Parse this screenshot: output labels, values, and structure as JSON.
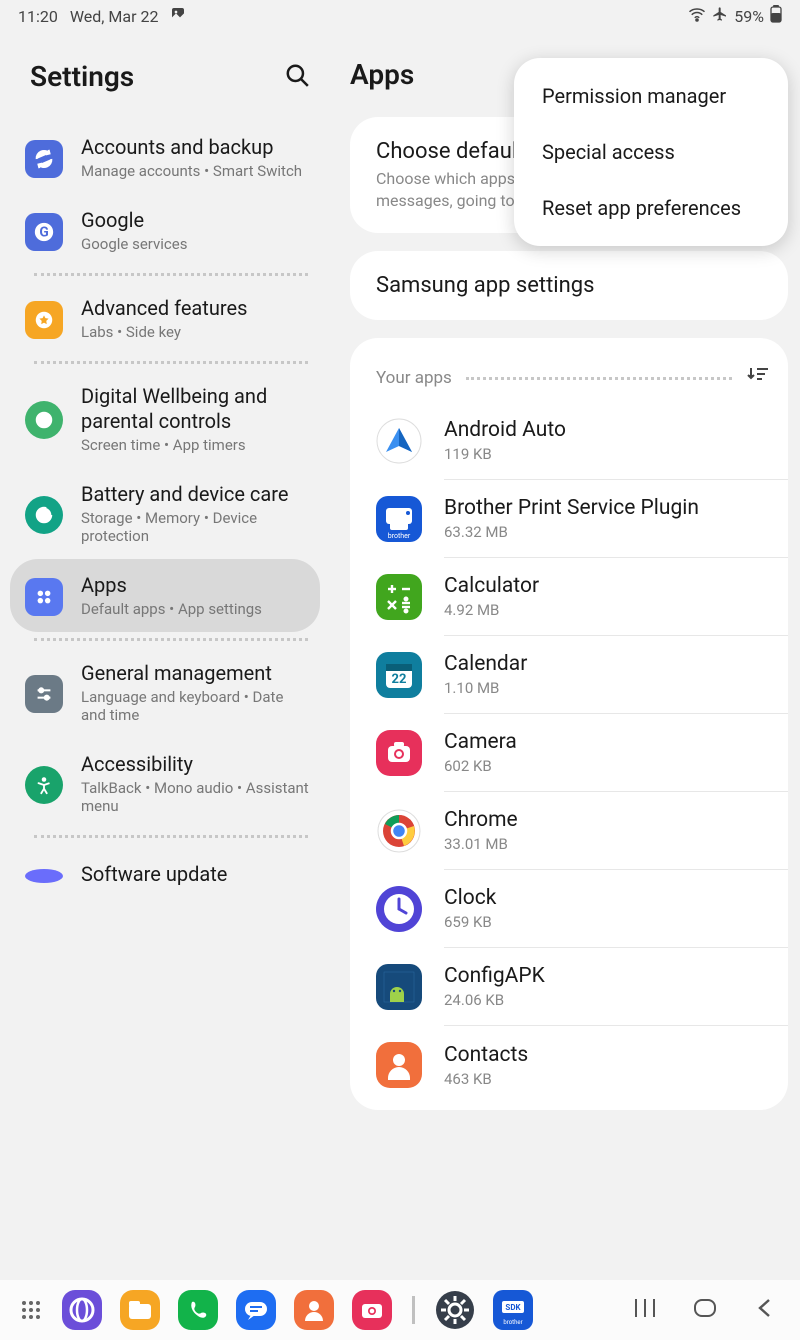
{
  "status": {
    "time": "11:20",
    "date": "Wed, Mar 22",
    "battery": "59%"
  },
  "left": {
    "title": "Settings",
    "items": [
      {
        "title": "Accounts and backup",
        "sub": "Manage accounts  •  Smart Switch",
        "color": "#4e6cdb",
        "icon": "sync"
      },
      {
        "title": "Google",
        "sub": "Google services",
        "color": "#4e6cdb",
        "icon": "google"
      }
    ],
    "item_adv": {
      "title": "Advanced features",
      "sub": "Labs  •  Side key",
      "color": "#f6a624",
      "icon": "gear-badge"
    },
    "item_wb": {
      "title": "Digital Wellbeing and parental controls",
      "sub": "Screen time  •  App timers",
      "color": "#3fb36d",
      "icon": "heart"
    },
    "item_bat": {
      "title": "Battery and device care",
      "sub": "Storage  •  Memory  •  Device protection",
      "color": "#12a386",
      "icon": "care"
    },
    "item_apps": {
      "title": "Apps",
      "sub": "Default apps  •  App settings",
      "color": "#5978f0",
      "icon": "grid"
    },
    "item_gm": {
      "title": "General management",
      "sub": "Language and keyboard  •  Date and time",
      "color": "#6b7a86",
      "icon": "sliders"
    },
    "item_acc": {
      "title": "Accessibility",
      "sub": "TalkBack  •  Mono audio  •  Assistant menu",
      "color": "#19a36b",
      "icon": "person"
    },
    "item_cut": {
      "title": "Software update"
    }
  },
  "right": {
    "title": "Apps",
    "card_default": {
      "title": "Choose default apps",
      "sub": "Choose which apps to use for making calls, sending messages, going to websites, and more."
    },
    "card_samsung": {
      "title": "Samsung app settings"
    },
    "your_apps_label": "Your apps",
    "apps": [
      {
        "name": "Android Auto",
        "size": "119 KB"
      },
      {
        "name": "Brother Print Service Plugin",
        "size": "63.32 MB"
      },
      {
        "name": "Calculator",
        "size": "4.92 MB"
      },
      {
        "name": "Calendar",
        "size": "1.10 MB"
      },
      {
        "name": "Camera",
        "size": "602 KB"
      },
      {
        "name": "Chrome",
        "size": "33.01 MB"
      },
      {
        "name": "Clock",
        "size": "659 KB"
      },
      {
        "name": "ConfigAPK",
        "size": "24.06 KB"
      },
      {
        "name": "Contacts",
        "size": "463 KB"
      }
    ]
  },
  "popup": {
    "items": [
      "Permission manager",
      "Special access",
      "Reset app preferences"
    ]
  }
}
